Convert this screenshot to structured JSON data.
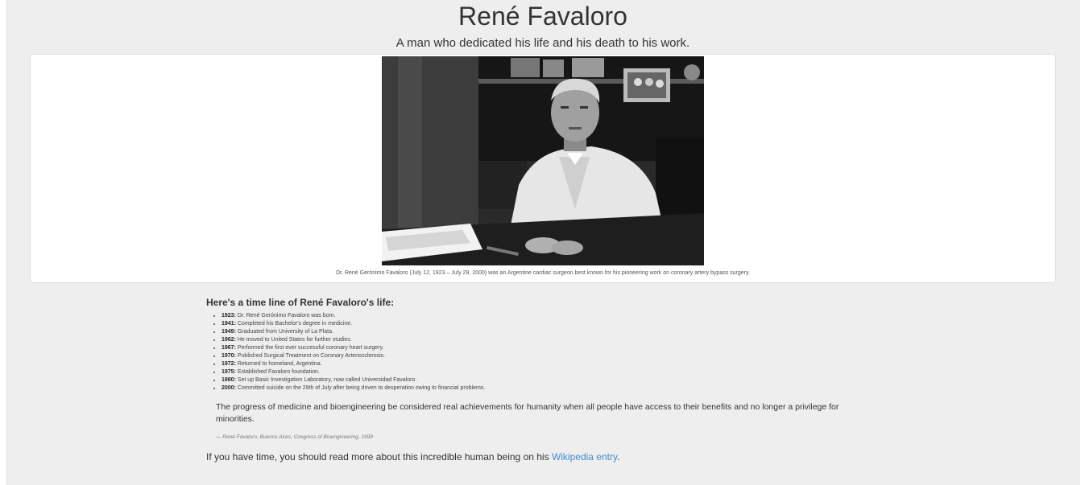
{
  "header": {
    "title": "René Favaloro",
    "subtitle": "A man who dedicated his life and his death to his work."
  },
  "figure": {
    "image_alt": "Dr. René Favaloro seated at his desk",
    "caption": "Dr. René Gerónimo Favaloro (July 12, 1923 – July 29, 2000) was an Argentine cardiac surgeon best known for his pioneering work on coronary artery bypass surgery."
  },
  "timeline": {
    "heading": "Here's a time line of René Favaloro's life:",
    "items": [
      {
        "year": "1923:",
        "text": "Dr. René Gerónimo Favaloro was born."
      },
      {
        "year": "1941:",
        "text": "Completed his Bachelor's degree in medicine."
      },
      {
        "year": "1949:",
        "text": "Graduated from University of La Plata."
      },
      {
        "year": "1962:",
        "text": "He moved to United States for further studies."
      },
      {
        "year": "1967:",
        "text": "Performed the first ever successful coronary heart surgery."
      },
      {
        "year": "1970:",
        "text": "Published Surgical Treatment on Coronary Arteriosclerosis."
      },
      {
        "year": "1972:",
        "text": "Returned to homeland, Argentina."
      },
      {
        "year": "1975:",
        "text": "Established Favaloro foundation."
      },
      {
        "year": "1980:",
        "text": "Set up Basic Investigation Laboratory, now called Universidad Favaloro."
      },
      {
        "year": "2000:",
        "text": "Committed suicide on the 29th of July after being driven to desperation owing to financial problems."
      }
    ]
  },
  "quote": {
    "text": "The progress of medicine and bioengineering be considered real achievements for humanity when all people have access to their benefits and no longer a privilege for minorities.",
    "source": "— René Favaloro, Buenos Aires, Congress of Bioengineering, 1999"
  },
  "footer": {
    "text_before": "If you have time, you should read more about this incredible human being on his ",
    "link_label": "Wikipedia entry",
    "text_after": "."
  },
  "colors": {
    "background": "#eeeeee",
    "link": "#428bca",
    "text": "#333333"
  }
}
